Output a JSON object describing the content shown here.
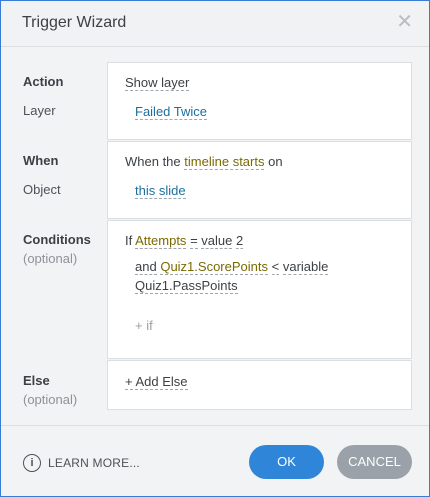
{
  "dialog": {
    "title": "Trigger Wizard",
    "close_glyph": "✕"
  },
  "action": {
    "label": "Action",
    "layer_label": "Layer",
    "value": "Show layer",
    "layer": "Failed Twice"
  },
  "when": {
    "label": "When",
    "object_label": "Object",
    "prefix": "When the",
    "event": "timeline starts",
    "suffix": "on",
    "object": "this slide"
  },
  "conditions": {
    "label": "Conditions",
    "optional": "(optional)",
    "if_word": "If",
    "var1": "Attempts",
    "op1": "=",
    "type1": "value",
    "val1": "2",
    "and_word": "and",
    "var2": "Quiz1.ScorePoints",
    "op2": "<",
    "type2": "variable",
    "val2": "Quiz1.PassPoints",
    "add_if": "+ if"
  },
  "else": {
    "label": "Else",
    "optional": "(optional)",
    "add": "+ Add Else"
  },
  "footer": {
    "info_glyph": "i",
    "learn_more": "LEARN MORE...",
    "ok": "OK",
    "cancel": "CANCEL"
  }
}
